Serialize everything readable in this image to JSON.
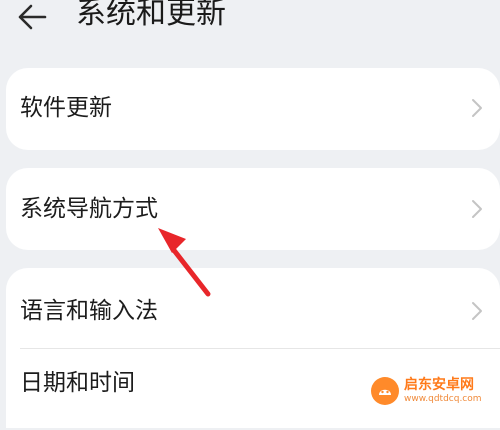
{
  "header": {
    "title": "系统和更新"
  },
  "items": [
    {
      "label": "软件更新"
    },
    {
      "label": "系统导航方式"
    },
    {
      "label": "语言和输入法"
    },
    {
      "label": "日期和时间"
    }
  ],
  "annotation": {
    "icon": "red-arrow-icon",
    "color": "#e8262a"
  },
  "watermark": {
    "name": "启东安卓网",
    "url": "www.qdtdcq.com",
    "color": "#ff7a1a"
  }
}
